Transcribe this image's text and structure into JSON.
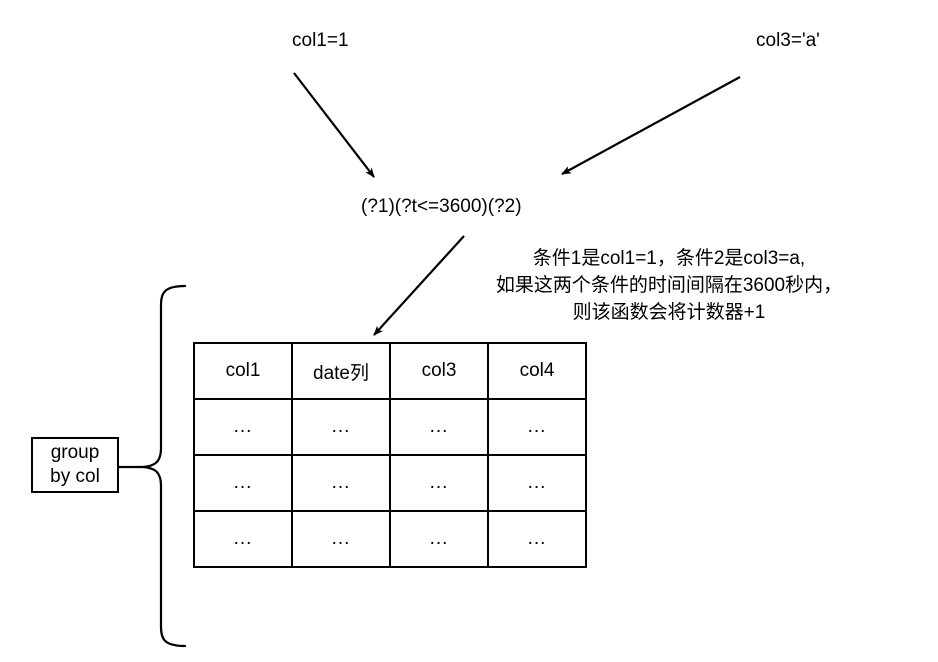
{
  "diagram": {
    "labels": {
      "condition1": "col1=1",
      "condition2": "col3='a'"
    },
    "pattern_expression": "(?1)(?t<=3600)(?2)",
    "annotation": "条件1是col1=1，条件2是col3=a,\n如果这两个条件的时间间隔在3600秒内，\n则该函数会将计数器+1",
    "group_by": {
      "line1": "group",
      "line2": "by col"
    }
  },
  "table": {
    "headers": [
      "col1",
      "date列",
      "col3",
      "col4"
    ],
    "rows": [
      [
        "...",
        "...",
        "...",
        "..."
      ],
      [
        "...",
        "...",
        "...",
        "..."
      ],
      [
        "...",
        "...",
        "...",
        "..."
      ]
    ]
  },
  "colors": {
    "stroke": "#000000",
    "background": "#ffffff"
  }
}
